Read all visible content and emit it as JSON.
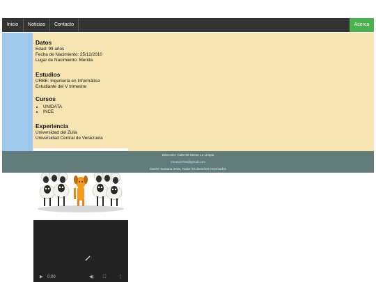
{
  "nav": {
    "items": [
      "Inicio",
      "Noticias",
      "Contacto"
    ],
    "accent": "Acerca"
  },
  "datos": {
    "heading": "Datos",
    "lines": [
      "Edad: 99 años",
      "Fecha de Nacimiento: 25/12/2010",
      "Lugar de Nacimiento: Merida"
    ]
  },
  "estudios": {
    "heading": "Estudios",
    "lines": [
      "URBE: Ingeniería en Informática",
      "Estudiante del V trimestre"
    ]
  },
  "cursos": {
    "heading": "Cursos",
    "items": [
      "UNIDATA",
      "INCE"
    ]
  },
  "experiencia": {
    "heading": "Experiencia",
    "lines": [
      "Universidad del Zulia",
      "Universidad Central de Venezuela"
    ]
  },
  "footer": {
    "address": "Dirección: Calle 60 Sector La Limpia",
    "email": "emuno0784@gmail.com",
    "copyright": "Dentre Santana 2016, Todos los derechos reservados"
  },
  "video": {
    "time": "0:00"
  },
  "colors": {
    "nav_bg": "#333333",
    "accent": "#4caf50",
    "sidebar": "#9fc9ec",
    "main_bg": "#f8e4b2",
    "footer_bg": "#607d7b"
  }
}
